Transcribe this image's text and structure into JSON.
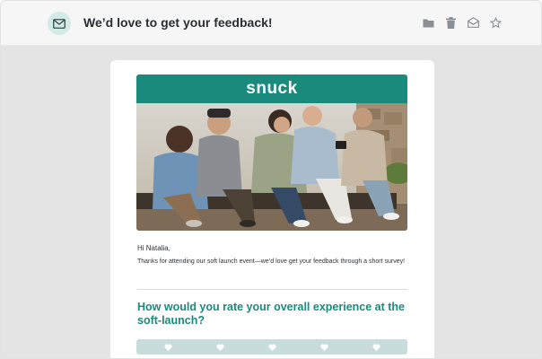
{
  "header": {
    "subject": "We’d love to get your feedback!",
    "icons": [
      "mail-icon",
      "folder-icon",
      "trash-icon",
      "envelope-open-icon",
      "star-icon"
    ]
  },
  "email": {
    "brand_name": "snuck",
    "hero_alt": "Group of friends sitting outdoors",
    "greeting": "Hi Natalia,",
    "body": "Thanks for attending our soft launch event—we’d love get your feedback through a short survey!",
    "question": "How would you rate your overall experience at the soft-launch?",
    "rating": {
      "count": 5,
      "icon": "heart-icon"
    }
  },
  "colors": {
    "brand": "#1a8a7d",
    "badge_bg": "#d3ebe7",
    "rating_bg": "#c8dcdc",
    "canvas_bg": "#e4e4e4"
  }
}
